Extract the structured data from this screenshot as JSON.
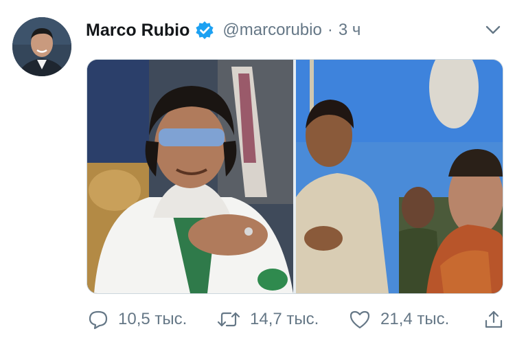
{
  "tweet": {
    "display_name": "Marco Rubio",
    "handle": "@marcorubio",
    "separator": "·",
    "time": "3 ч",
    "verified": true
  },
  "media": {
    "images": [
      {
        "icon": "photo-leader-in-white-suit"
      },
      {
        "icon": "photo-crowd-outdoors"
      }
    ]
  },
  "actions": {
    "reply_count": "10,5 тыс.",
    "retweet_count": "14,7 тыс.",
    "like_count": "21,4 тыс."
  },
  "colors": {
    "verified": "#1da1f2",
    "secondary_text": "#657786",
    "primary_text": "#14171a",
    "border": "#ccd6dd"
  }
}
